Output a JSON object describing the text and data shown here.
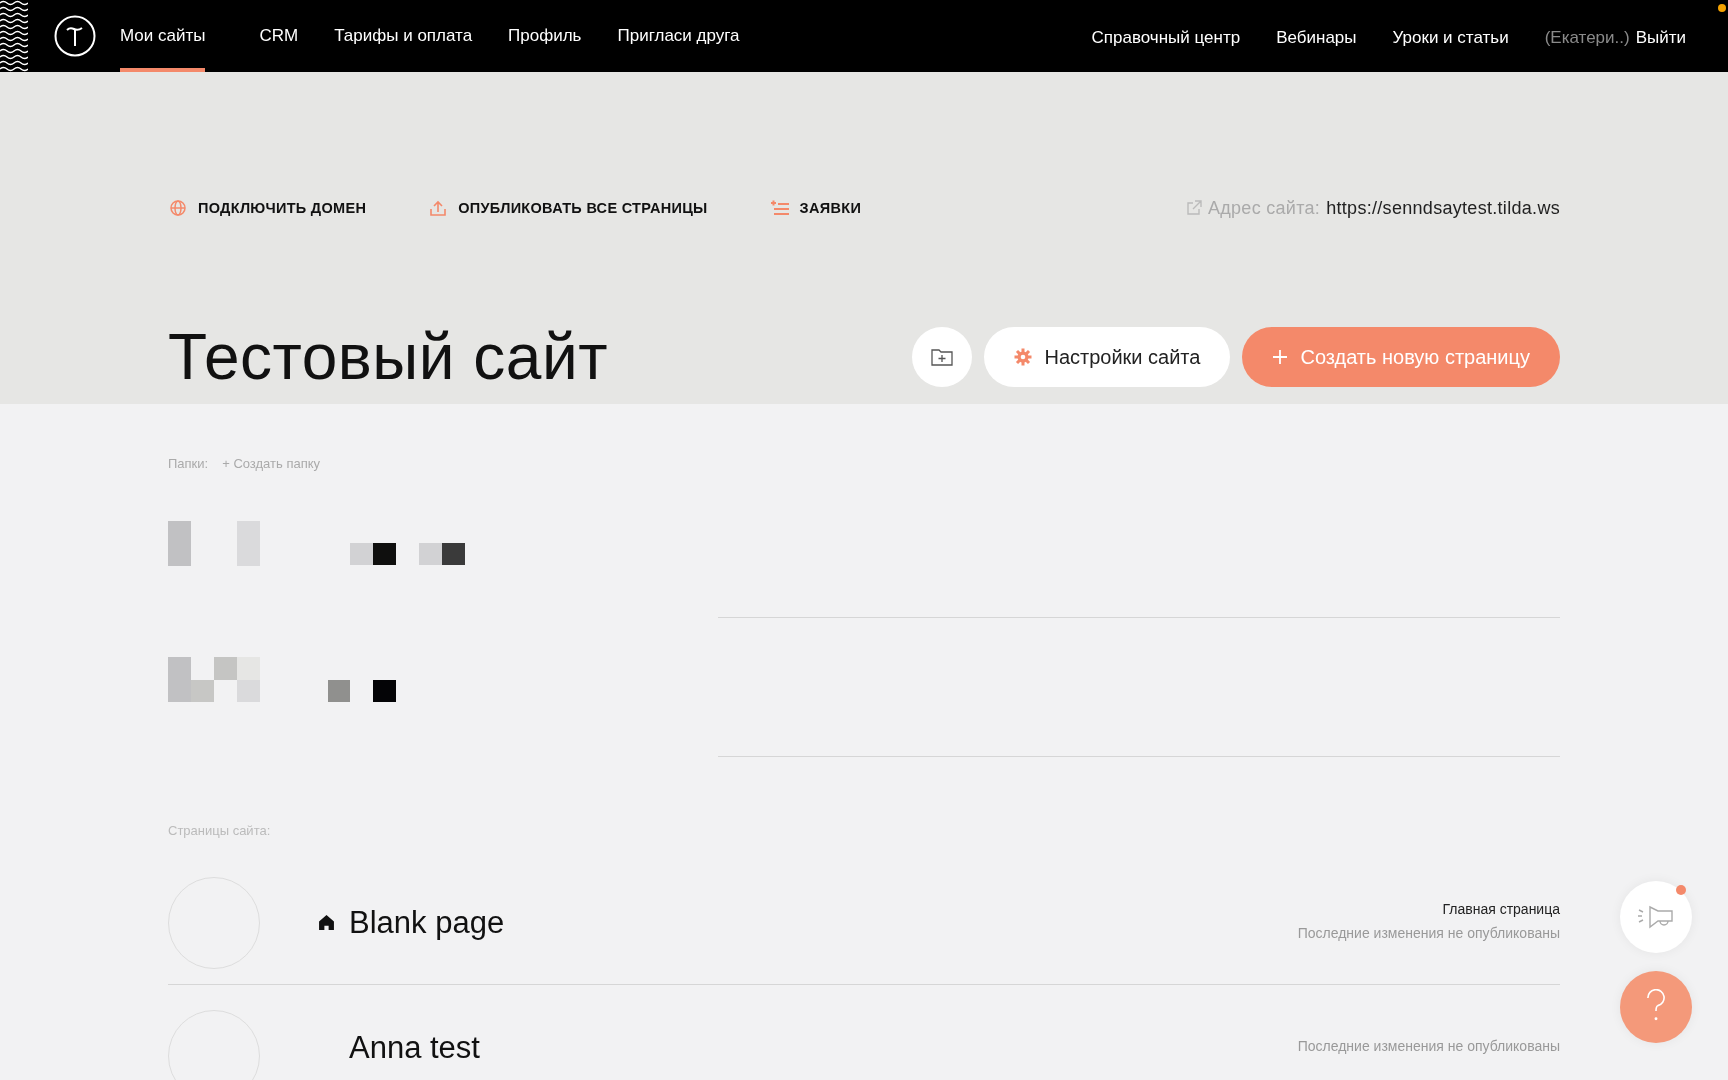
{
  "header": {
    "nav": [
      {
        "label": "Мои сайты",
        "selected": true
      },
      {
        "label": "CRM",
        "selected": false
      },
      {
        "label": "Тарифы и оплата",
        "selected": false
      },
      {
        "label": "Профиль",
        "selected": false
      },
      {
        "label": "Пригласи друга",
        "selected": false
      }
    ],
    "links": [
      "Справочный центр",
      "Вебинары",
      "Уроки и статьи"
    ],
    "user": "(Екатери..)",
    "logout": "Выйти"
  },
  "toolbar": {
    "actions": [
      {
        "kind": "domain",
        "label": "ПОДКЛЮЧИТЬ ДОМЕН"
      },
      {
        "kind": "publish",
        "label": "ОПУБЛИКОВАТЬ ВСЕ СТРАНИЦЫ"
      },
      {
        "kind": "leads",
        "label": "ЗАЯВКИ"
      }
    ],
    "address_label": "Адрес сайта:",
    "address": "https://senndsaytest.tilda.ws"
  },
  "site": {
    "title": "Тестовый сайт",
    "settings_button": "Настройки сайта",
    "create_button": "Создать новую страницу"
  },
  "folders": {
    "label": "Папки:",
    "create_link": "+ Создать папку",
    "items": [
      {
        "kind": "pixelated"
      },
      {
        "kind": "pixelated"
      }
    ]
  },
  "pages": {
    "label": "Страницы сайта:",
    "items": [
      {
        "title": "Blank page",
        "home": true,
        "status": "Главная страница",
        "note": "Последние изменения не опубликованы"
      },
      {
        "title": "Anna test",
        "home": false,
        "note": "Последние изменения не опубликованы"
      }
    ]
  }
}
